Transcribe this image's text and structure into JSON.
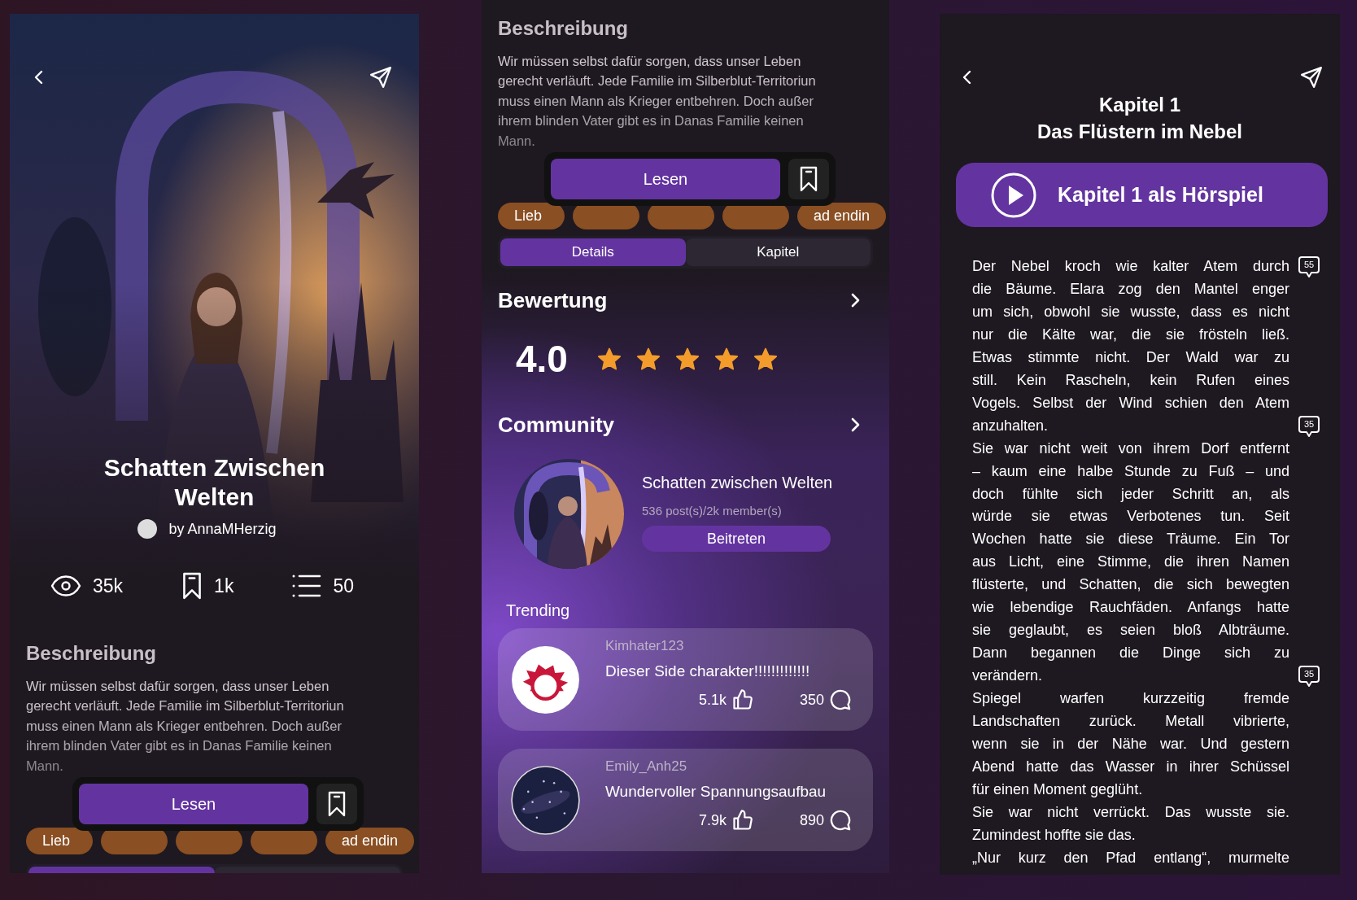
{
  "cover_detail": {
    "title": "Schatten Zwischen Welten",
    "author": "by AnnaMHerzig",
    "stats": [
      {
        "kind": "views",
        "value": "35k"
      },
      {
        "kind": "bookmarks",
        "value": "1k"
      },
      {
        "kind": "chapters",
        "value": "50"
      }
    ],
    "description": {
      "heading": "Beschreibung",
      "lines": [
        "Wir müssen selbst dafür sorgen, dass unser Leben",
        "gerecht verläuft. Jede Familie im Silberblut-Territoriun",
        "muss einen Mann als Krieger entbehren. Doch außer",
        "ihrem blinden Vater gibt es in Danas Familie keinen",
        "Mann."
      ]
    },
    "read_button": "Lesen",
    "tags": [
      {
        "kind": "tag",
        "label": "Lieb"
      },
      {
        "kind": "covered"
      },
      {
        "kind": "covered"
      },
      {
        "kind": "covered"
      },
      {
        "kind": "tag",
        "label": "ad endin"
      }
    ],
    "tabs": [
      {
        "selected": true
      },
      {
        "selected": false
      }
    ]
  },
  "scrolled_detail": {
    "description": {
      "heading": "Beschreibung",
      "lines": [
        "Wir müssen selbst dafür sorgen, dass unser Leben",
        "gerecht verläuft. Jede Familie im Silberblut-Territoriun",
        "muss einen Mann als Krieger entbehren. Doch außer",
        "ihrem blinden Vater gibt es in Danas Familie keinen",
        "Mann."
      ]
    },
    "read_button": "Lesen",
    "tags": [
      {
        "kind": "tag",
        "label": "Lieb"
      },
      {
        "kind": "covered"
      },
      {
        "kind": "covered"
      },
      {
        "kind": "covered"
      },
      {
        "kind": "tag",
        "label": "ad endin"
      }
    ],
    "tabs": [
      {
        "label": "Details",
        "selected": true
      },
      {
        "label": "Kapitel",
        "selected": false
      }
    ],
    "rating": {
      "heading": "Bewertung",
      "score": "4.0",
      "stars": 5
    },
    "community": {
      "heading": "Community",
      "name": "Schatten zwischen Welten",
      "stats": "536 post(s)/2k member(s)",
      "join_button": "Beitreten"
    },
    "trending": {
      "heading": "Trending",
      "posts": [
        {
          "avatar": {
            "kind": "icon"
          },
          "user": "Kimhater123",
          "text": "Dieser Side charakter!!!!!!!!!!!!!",
          "likes": "5.1k",
          "comments": "350"
        },
        {
          "user": "Emily_Anh25",
          "text": "Wundervoller Spannungsaufbau",
          "likes": "7.9k",
          "comments": "890"
        }
      ]
    }
  },
  "chapter_reader": {
    "chapter": "Kapitel 1",
    "chapter_title": "Das Flüstern im Nebel",
    "audio_button": "Kapitel 1 als Hörspiel",
    "paragraphs": [
      {
        "lines": [
          {
            "text": "Der Nebel kroch wie kalter Atem durch",
            "comments": "55"
          },
          {
            "text": "die Bäume. Elara zog den Mantel enger"
          },
          {
            "text": "um sich, obwohl sie wusste, dass es nicht"
          },
          {
            "text": "nur die Kälte war, die sie frösteln ließ."
          },
          {
            "text": "Etwas stimmte nicht. Der Wald war zu"
          },
          {
            "text": "still. Kein Rascheln, kein Rufen eines"
          },
          {
            "text": "Vogels. Selbst der Wind schien den Atem"
          },
          {
            "text": "anzuhalten.",
            "comments": "35"
          }
        ]
      },
      {
        "lines": [
          {
            "text": "Sie war nicht weit von ihrem Dorf entfernt"
          },
          {
            "text": "– kaum eine halbe Stunde zu Fuß – und"
          },
          {
            "text": "doch fühlte sich jeder Schritt an, als"
          },
          {
            "text": "würde sie etwas Verbotenes tun. Seit"
          },
          {
            "text": "Wochen hatte sie diese Träume. Ein Tor"
          },
          {
            "text": "aus Licht, eine Stimme, die ihren Namen"
          },
          {
            "text": "flüsterte, und Schatten, die sich bewegten"
          },
          {
            "text": "wie lebendige Rauchfäden. Anfangs hatte"
          },
          {
            "text": "sie geglaubt, es seien bloß Albträume."
          },
          {
            "text": "Dann begannen die Dinge sich zu"
          },
          {
            "text": "verändern.",
            "comments": "35"
          }
        ]
      },
      {
        "lines": [
          {
            "text": "Spiegel warfen kurzzeitig fremde"
          },
          {
            "text": "Landschaften zurück. Metall vibrierte,"
          },
          {
            "text": "wenn sie in der Nähe war. Und gestern"
          },
          {
            "text": "Abend hatte das Wasser in ihrer Schüssel"
          },
          {
            "text": "für einen Moment geglüht."
          }
        ]
      },
      {
        "lines": [
          {
            "text": "Sie war nicht verrückt. Das wusste sie."
          },
          {
            "text": "Zumindest hoffte sie das."
          }
        ]
      },
      {
        "continues": true,
        "lines": [
          {
            "text": "„Nur kurz den Pfad entlang“, murmelte"
          }
        ]
      }
    ]
  }
}
